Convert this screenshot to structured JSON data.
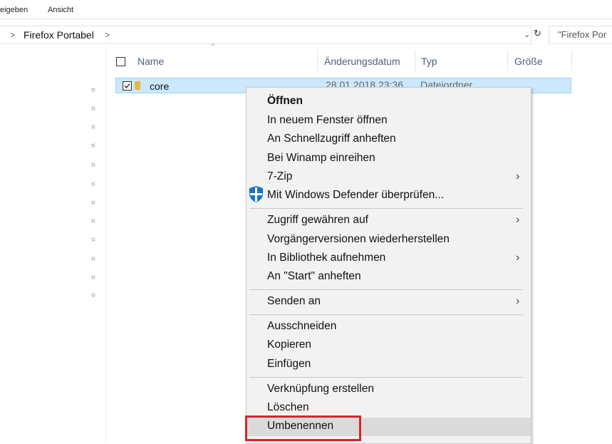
{
  "ribbon": {
    "tab_share": "eigeben",
    "tab_view": "Ansicht"
  },
  "address": {
    "breadcrumb": "Firefox Portabel",
    "search_placeholder": "\"Firefox Por"
  },
  "columns": {
    "name": "Name",
    "date": "Änderungsdatum",
    "type": "Typ",
    "size": "Größe"
  },
  "file_row": {
    "name": "core",
    "date": "28.01.2018 23:36",
    "type": "Dateiordner"
  },
  "menu": {
    "open": "Öffnen",
    "open_new_window": "In neuem Fenster öffnen",
    "pin_quick_access": "An Schnellzugriff anheften",
    "winamp": "Bei Winamp einreihen",
    "zip": "7-Zip",
    "defender": "Mit Windows Defender überprüfen...",
    "grant_access": "Zugriff gewähren auf",
    "restore_versions": "Vorgängerversionen wiederherstellen",
    "include_library": "In Bibliothek aufnehmen",
    "pin_start": "An \"Start\" anheften",
    "send_to": "Senden an",
    "cut": "Ausschneiden",
    "copy": "Kopieren",
    "paste": "Einfügen",
    "create_shortcut": "Verknüpfung erstellen",
    "delete": "Löschen",
    "rename": "Umbenennen"
  },
  "colors": {
    "selection": "#cce8ff",
    "highlight_box": "#d9232a",
    "defender_blue": "#1e73c8"
  }
}
